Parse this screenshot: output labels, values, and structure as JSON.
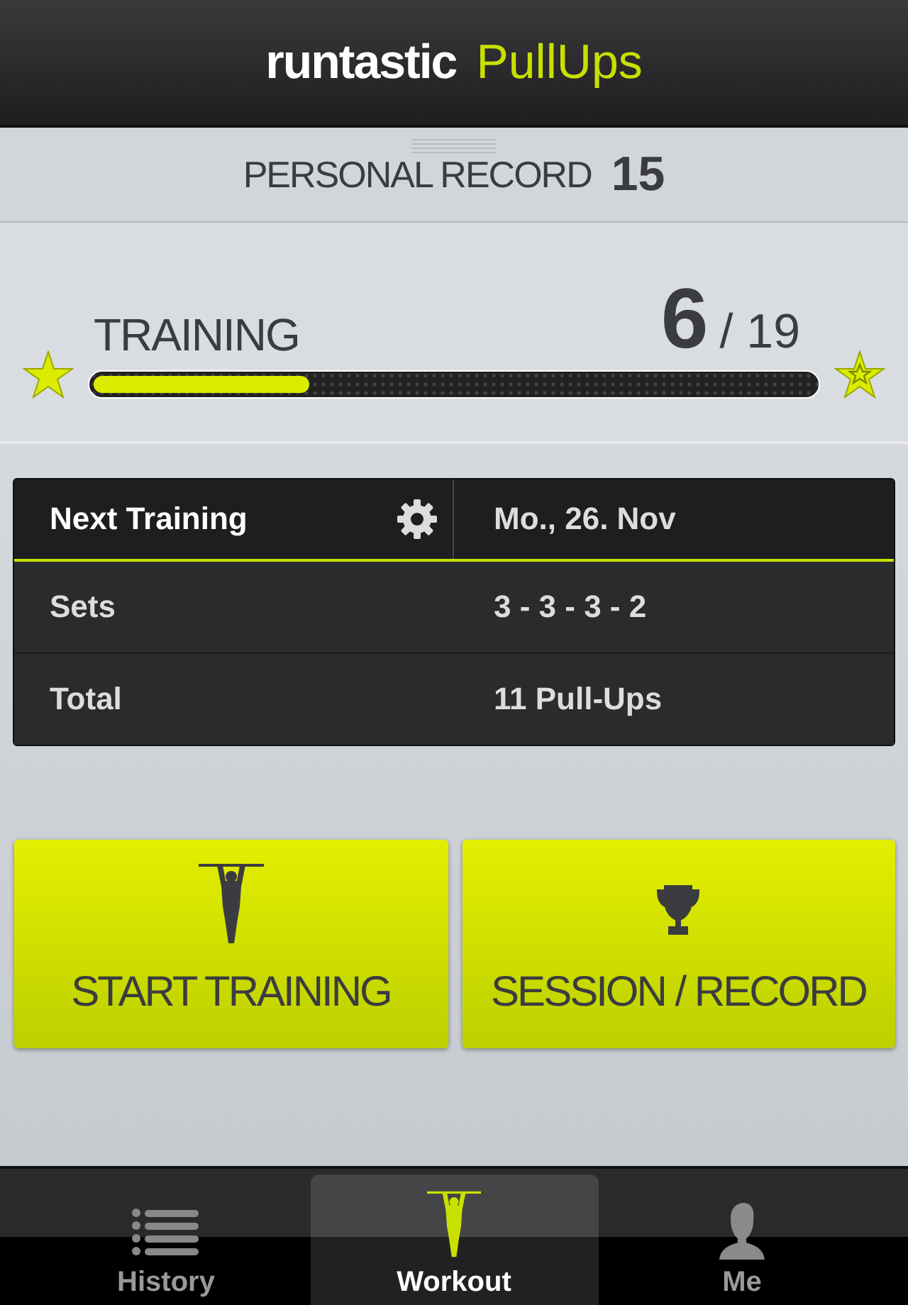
{
  "header": {
    "brand": "runtastic",
    "product": "PullUps"
  },
  "personal_record": {
    "label": "PERSONAL RECORD",
    "value": "15"
  },
  "training": {
    "label": "TRAINING",
    "current": "6",
    "total": "/ 19",
    "level": 0.3
  },
  "plan_rows": [
    {
      "kind": "header",
      "label": "Next Training",
      "value": "Mo., 26. Nov"
    },
    {
      "kind": "plain",
      "label": "Sets",
      "value": "3 - 3 - 3 - 2"
    },
    {
      "kind": "plain",
      "label": "Total",
      "value": "11 Pull-Ups"
    }
  ],
  "actions": [
    {
      "label": "START TRAINING"
    },
    {
      "label": "SESSION / RECORD"
    }
  ],
  "tabs": [
    {
      "label": "History",
      "selected": false
    },
    {
      "label": "Workout",
      "selected": true
    },
    {
      "label": "Me",
      "selected": false
    }
  ]
}
